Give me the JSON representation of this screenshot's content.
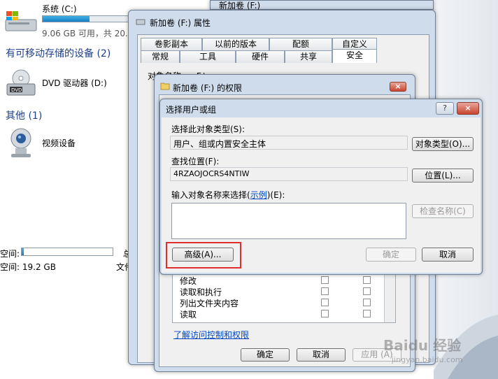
{
  "explorer": {
    "drive_c_name": "系统 (C:)",
    "drive_c_info": "9.06 GB 可用，共 20.4",
    "drive_c_fill_fraction": 0.55,
    "removable_header": "有可移动存储的设备 (2)",
    "dvd_name": "DVD 驱动器 (D:)",
    "other_header": "其他 (1)",
    "video_device": "视频设备",
    "left_space_label": "空间:",
    "left_total_label": "空间: 19.2 GB",
    "left_clip_1": "总",
    "left_clip_2": "文件"
  },
  "props": {
    "behind_title": "新加卷 (F:)",
    "title": "新加卷 (F:) 属性",
    "tabs_row1": [
      "卷影副本",
      "以前的版本",
      "配额",
      "自定义"
    ],
    "tabs_row2": [
      "常规",
      "工具",
      "硬件",
      "共享",
      "安全"
    ],
    "object_name_label": "对象名称:",
    "object_name_value": "F:\\",
    "ok": "确定",
    "cancel": "取消",
    "apply": "应用"
  },
  "perms": {
    "title": "新加卷 (F:) 的权限",
    "items": [
      "修改",
      "读取和执行",
      "列出文件夹内容",
      "读取"
    ],
    "link": "了解访问控制和权限",
    "ok": "确定",
    "cancel": "取消",
    "apply": "应用 (A)"
  },
  "select": {
    "title": "选择用户或组",
    "help": "?",
    "close": "×",
    "object_type_label": "选择此对象类型(S):",
    "object_type_value": "用户、组或内置安全主体",
    "object_type_button": "对象类型(O)...",
    "location_label": "查找位置(F):",
    "location_value": "4RZAOJOCRS4NTIW",
    "location_button": "位置(L)...",
    "names_label": "输入对象名称来选择",
    "names_label_link": "示例",
    "names_label_suffix": "(E):",
    "check_names": "检查名称(C)",
    "advanced": "高级(A)...",
    "ok": "确定",
    "cancel": "取消"
  },
  "watermark": {
    "text": "Baidu 经验",
    "sub": "jingyan.baidu.com"
  }
}
